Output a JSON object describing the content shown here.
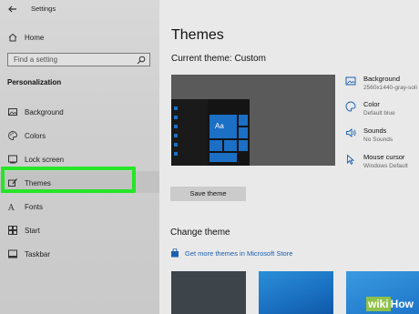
{
  "window": {
    "title": "Settings"
  },
  "sidebar": {
    "home_label": "Home",
    "search_placeholder": "Find a setting",
    "section_heading": "Personalization",
    "items": [
      {
        "label": "Background",
        "icon": "picture-icon"
      },
      {
        "label": "Colors",
        "icon": "palette-icon"
      },
      {
        "label": "Lock screen",
        "icon": "lock-screen-icon"
      },
      {
        "label": "Themes",
        "icon": "brush-icon"
      },
      {
        "label": "Fonts",
        "icon": "fonts-icon"
      },
      {
        "label": "Start",
        "icon": "start-icon"
      },
      {
        "label": "Taskbar",
        "icon": "taskbar-icon"
      }
    ],
    "selected": "Themes",
    "highlight_color": "#27e527"
  },
  "main": {
    "title": "Themes",
    "current_theme": "Current theme: Custom",
    "preview": {
      "tile_label": "Aa"
    },
    "theme_items": [
      {
        "title": "Background",
        "sub": "2560x1440-gray-soli",
        "icon": "picture-icon"
      },
      {
        "title": "Color",
        "sub": "Default blue",
        "icon": "palette-icon"
      },
      {
        "title": "Sounds",
        "sub": "No Sounds",
        "icon": "speaker-icon"
      },
      {
        "title": "Mouse cursor",
        "sub": "Windows Default",
        "icon": "cursor-icon"
      }
    ],
    "save_button": "Save theme",
    "change_theme": "Change theme",
    "store_link": "Get more themes in Microsoft Store"
  },
  "watermark": {
    "part1": "wiki",
    "part2": "How"
  },
  "colors": {
    "accent": "#1b6fc5",
    "link": "#1b5fae"
  }
}
